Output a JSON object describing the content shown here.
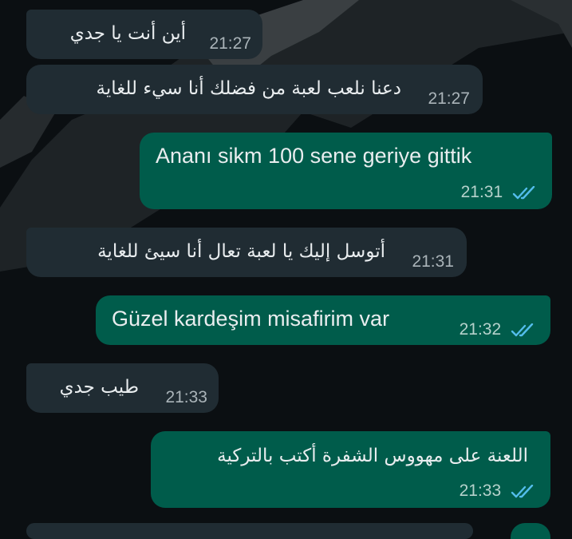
{
  "messages": [
    {
      "direction": "incoming",
      "text": "أين أنت يا جدي",
      "time": "21:27"
    },
    {
      "direction": "incoming",
      "text": "دعنا نلعب لعبة من فضلك أنا سيء للغاية",
      "time": "21:27"
    },
    {
      "direction": "outgoing",
      "text": "Ananı sikm 100 sene geriye gittik",
      "time": "21:31",
      "status": "read"
    },
    {
      "direction": "incoming",
      "text": "أتوسل إليك يا لعبة تعال أنا سيئ للغاية",
      "time": "21:31"
    },
    {
      "direction": "outgoing",
      "text": "Güzel kardeşim misafirim var",
      "time": "21:32",
      "status": "read"
    },
    {
      "direction": "incoming",
      "text": "طيب جدي",
      "time": "21:33"
    },
    {
      "direction": "outgoing",
      "text": "اللعنة على مهووس الشفرة أكتب بالتركية",
      "time": "21:33",
      "status": "read"
    }
  ],
  "icons": {
    "read_receipt": "double-check-icon"
  },
  "colors": {
    "incoming_bubble": "#202c33",
    "outgoing_bubble": "#005c4b",
    "read_tick": "#53bdeb",
    "background": "#0b0f12"
  }
}
